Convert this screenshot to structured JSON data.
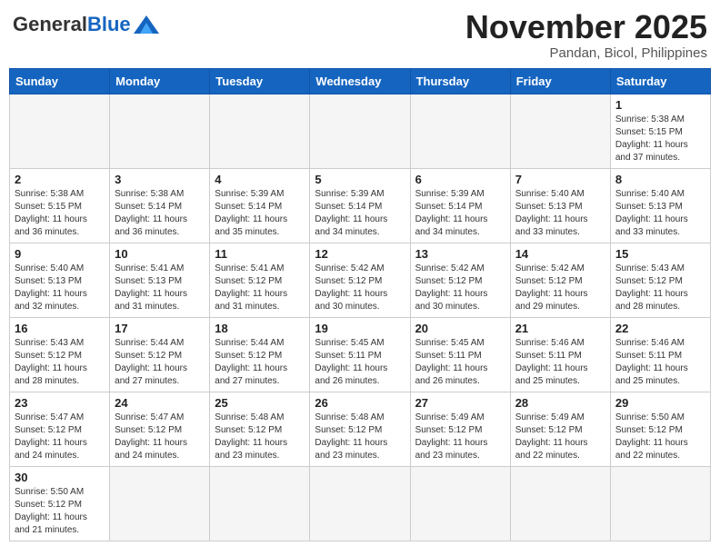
{
  "header": {
    "logo_general": "General",
    "logo_blue": "Blue",
    "month_title": "November 2025",
    "location": "Pandan, Bicol, Philippines"
  },
  "weekdays": [
    "Sunday",
    "Monday",
    "Tuesday",
    "Wednesday",
    "Thursday",
    "Friday",
    "Saturday"
  ],
  "days": [
    {
      "day": "",
      "sunrise": "",
      "sunset": "",
      "daylight": "",
      "empty": true
    },
    {
      "day": "",
      "sunrise": "",
      "sunset": "",
      "daylight": "",
      "empty": true
    },
    {
      "day": "",
      "sunrise": "",
      "sunset": "",
      "daylight": "",
      "empty": true
    },
    {
      "day": "",
      "sunrise": "",
      "sunset": "",
      "daylight": "",
      "empty": true
    },
    {
      "day": "",
      "sunrise": "",
      "sunset": "",
      "daylight": "",
      "empty": true
    },
    {
      "day": "",
      "sunrise": "",
      "sunset": "",
      "daylight": "",
      "empty": true
    },
    {
      "day": "1",
      "sunrise": "Sunrise: 5:38 AM",
      "sunset": "Sunset: 5:15 PM",
      "daylight": "Daylight: 11 hours and 37 minutes."
    },
    {
      "day": "2",
      "sunrise": "Sunrise: 5:38 AM",
      "sunset": "Sunset: 5:15 PM",
      "daylight": "Daylight: 11 hours and 36 minutes."
    },
    {
      "day": "3",
      "sunrise": "Sunrise: 5:38 AM",
      "sunset": "Sunset: 5:14 PM",
      "daylight": "Daylight: 11 hours and 36 minutes."
    },
    {
      "day": "4",
      "sunrise": "Sunrise: 5:39 AM",
      "sunset": "Sunset: 5:14 PM",
      "daylight": "Daylight: 11 hours and 35 minutes."
    },
    {
      "day": "5",
      "sunrise": "Sunrise: 5:39 AM",
      "sunset": "Sunset: 5:14 PM",
      "daylight": "Daylight: 11 hours and 34 minutes."
    },
    {
      "day": "6",
      "sunrise": "Sunrise: 5:39 AM",
      "sunset": "Sunset: 5:14 PM",
      "daylight": "Daylight: 11 hours and 34 minutes."
    },
    {
      "day": "7",
      "sunrise": "Sunrise: 5:40 AM",
      "sunset": "Sunset: 5:13 PM",
      "daylight": "Daylight: 11 hours and 33 minutes."
    },
    {
      "day": "8",
      "sunrise": "Sunrise: 5:40 AM",
      "sunset": "Sunset: 5:13 PM",
      "daylight": "Daylight: 11 hours and 33 minutes."
    },
    {
      "day": "9",
      "sunrise": "Sunrise: 5:40 AM",
      "sunset": "Sunset: 5:13 PM",
      "daylight": "Daylight: 11 hours and 32 minutes."
    },
    {
      "day": "10",
      "sunrise": "Sunrise: 5:41 AM",
      "sunset": "Sunset: 5:13 PM",
      "daylight": "Daylight: 11 hours and 31 minutes."
    },
    {
      "day": "11",
      "sunrise": "Sunrise: 5:41 AM",
      "sunset": "Sunset: 5:12 PM",
      "daylight": "Daylight: 11 hours and 31 minutes."
    },
    {
      "day": "12",
      "sunrise": "Sunrise: 5:42 AM",
      "sunset": "Sunset: 5:12 PM",
      "daylight": "Daylight: 11 hours and 30 minutes."
    },
    {
      "day": "13",
      "sunrise": "Sunrise: 5:42 AM",
      "sunset": "Sunset: 5:12 PM",
      "daylight": "Daylight: 11 hours and 30 minutes."
    },
    {
      "day": "14",
      "sunrise": "Sunrise: 5:42 AM",
      "sunset": "Sunset: 5:12 PM",
      "daylight": "Daylight: 11 hours and 29 minutes."
    },
    {
      "day": "15",
      "sunrise": "Sunrise: 5:43 AM",
      "sunset": "Sunset: 5:12 PM",
      "daylight": "Daylight: 11 hours and 28 minutes."
    },
    {
      "day": "16",
      "sunrise": "Sunrise: 5:43 AM",
      "sunset": "Sunset: 5:12 PM",
      "daylight": "Daylight: 11 hours and 28 minutes."
    },
    {
      "day": "17",
      "sunrise": "Sunrise: 5:44 AM",
      "sunset": "Sunset: 5:12 PM",
      "daylight": "Daylight: 11 hours and 27 minutes."
    },
    {
      "day": "18",
      "sunrise": "Sunrise: 5:44 AM",
      "sunset": "Sunset: 5:12 PM",
      "daylight": "Daylight: 11 hours and 27 minutes."
    },
    {
      "day": "19",
      "sunrise": "Sunrise: 5:45 AM",
      "sunset": "Sunset: 5:11 PM",
      "daylight": "Daylight: 11 hours and 26 minutes."
    },
    {
      "day": "20",
      "sunrise": "Sunrise: 5:45 AM",
      "sunset": "Sunset: 5:11 PM",
      "daylight": "Daylight: 11 hours and 26 minutes."
    },
    {
      "day": "21",
      "sunrise": "Sunrise: 5:46 AM",
      "sunset": "Sunset: 5:11 PM",
      "daylight": "Daylight: 11 hours and 25 minutes."
    },
    {
      "day": "22",
      "sunrise": "Sunrise: 5:46 AM",
      "sunset": "Sunset: 5:11 PM",
      "daylight": "Daylight: 11 hours and 25 minutes."
    },
    {
      "day": "23",
      "sunrise": "Sunrise: 5:47 AM",
      "sunset": "Sunset: 5:12 PM",
      "daylight": "Daylight: 11 hours and 24 minutes."
    },
    {
      "day": "24",
      "sunrise": "Sunrise: 5:47 AM",
      "sunset": "Sunset: 5:12 PM",
      "daylight": "Daylight: 11 hours and 24 minutes."
    },
    {
      "day": "25",
      "sunrise": "Sunrise: 5:48 AM",
      "sunset": "Sunset: 5:12 PM",
      "daylight": "Daylight: 11 hours and 23 minutes."
    },
    {
      "day": "26",
      "sunrise": "Sunrise: 5:48 AM",
      "sunset": "Sunset: 5:12 PM",
      "daylight": "Daylight: 11 hours and 23 minutes."
    },
    {
      "day": "27",
      "sunrise": "Sunrise: 5:49 AM",
      "sunset": "Sunset: 5:12 PM",
      "daylight": "Daylight: 11 hours and 23 minutes."
    },
    {
      "day": "28",
      "sunrise": "Sunrise: 5:49 AM",
      "sunset": "Sunset: 5:12 PM",
      "daylight": "Daylight: 11 hours and 22 minutes."
    },
    {
      "day": "29",
      "sunrise": "Sunrise: 5:50 AM",
      "sunset": "Sunset: 5:12 PM",
      "daylight": "Daylight: 11 hours and 22 minutes."
    },
    {
      "day": "30",
      "sunrise": "Sunrise: 5:50 AM",
      "sunset": "Sunset: 5:12 PM",
      "daylight": "Daylight: 11 hours and 21 minutes."
    },
    {
      "day": "",
      "sunrise": "",
      "sunset": "",
      "daylight": "",
      "empty": true
    },
    {
      "day": "",
      "sunrise": "",
      "sunset": "",
      "daylight": "",
      "empty": true
    },
    {
      "day": "",
      "sunrise": "",
      "sunset": "",
      "daylight": "",
      "empty": true
    },
    {
      "day": "",
      "sunrise": "",
      "sunset": "",
      "daylight": "",
      "empty": true
    },
    {
      "day": "",
      "sunrise": "",
      "sunset": "",
      "daylight": "",
      "empty": true
    },
    {
      "day": "",
      "sunrise": "",
      "sunset": "",
      "daylight": "",
      "empty": true
    }
  ]
}
